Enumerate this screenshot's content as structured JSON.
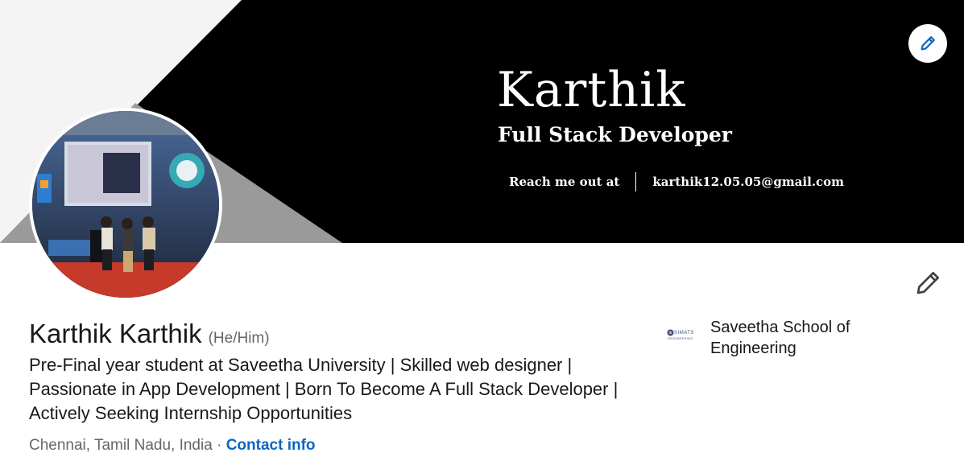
{
  "banner": {
    "name": "Karthik",
    "role": "Full Stack Developer",
    "reach_label": "Reach me out at",
    "email": "karthik12.05.05@gmail.com"
  },
  "profile": {
    "name": "Karthik Karthik",
    "pronouns": "(He/Him)",
    "headline": "Pre-Final year student at Saveetha University | Skilled web designer | Passionate in App Development | Born To Become A Full Stack Developer | Actively Seeking Internship Opportunities",
    "location": "Chennai, Tamil Nadu, India",
    "separator": "·",
    "contact_label": "Contact info"
  },
  "education": {
    "logo_text": "SIMATS",
    "logo_sub": "ENGINEERING",
    "name": "Saveetha School of Engineering"
  },
  "icons": {
    "edit_banner": "pencil-icon",
    "edit_intro": "pencil-icon"
  },
  "colors": {
    "link": "#0a66c2",
    "muted": "#666666",
    "text": "#191919"
  }
}
